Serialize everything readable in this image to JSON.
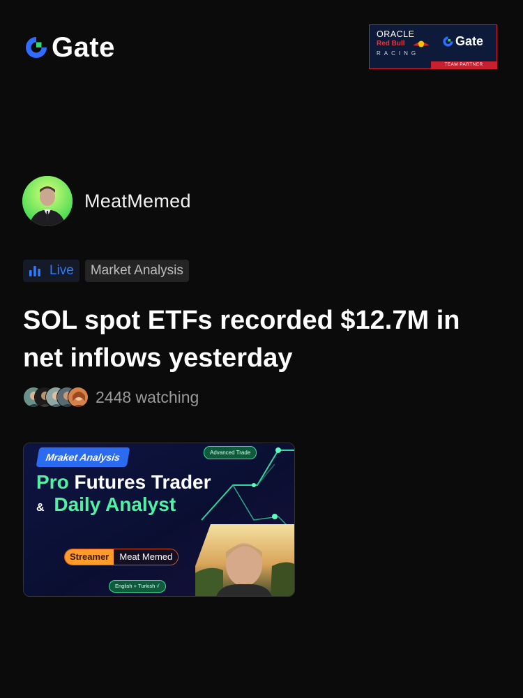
{
  "brand": {
    "name": "Gate",
    "accent": "#2f7dff",
    "green": "#2fd870"
  },
  "partner": {
    "line1": "ORACLE",
    "line2": "Red Bull",
    "line3": "RACING",
    "brand": "Gate",
    "tagline": "TEAM PARTNER"
  },
  "author": {
    "name": "MeatMemed",
    "avatar_icon": "person-avatar-icon"
  },
  "tags": {
    "live_label": "Live",
    "category": "Market Analysis"
  },
  "post": {
    "title": "SOL spot ETFs recorded $12.7M in net inflows yesterday"
  },
  "viewers": {
    "count_text": "2448 watching"
  },
  "thumbnail": {
    "badge": "Mraket Analysis",
    "advanced": "Advanced Trade",
    "line1_a": "Pro",
    "line1_b": "Futures Trader",
    "line2_amp": "&",
    "line2_b": "Daily Analyst",
    "streamer_key": "Streamer",
    "streamer_name": "Meat Memed",
    "lang": "English + Turkish √"
  }
}
